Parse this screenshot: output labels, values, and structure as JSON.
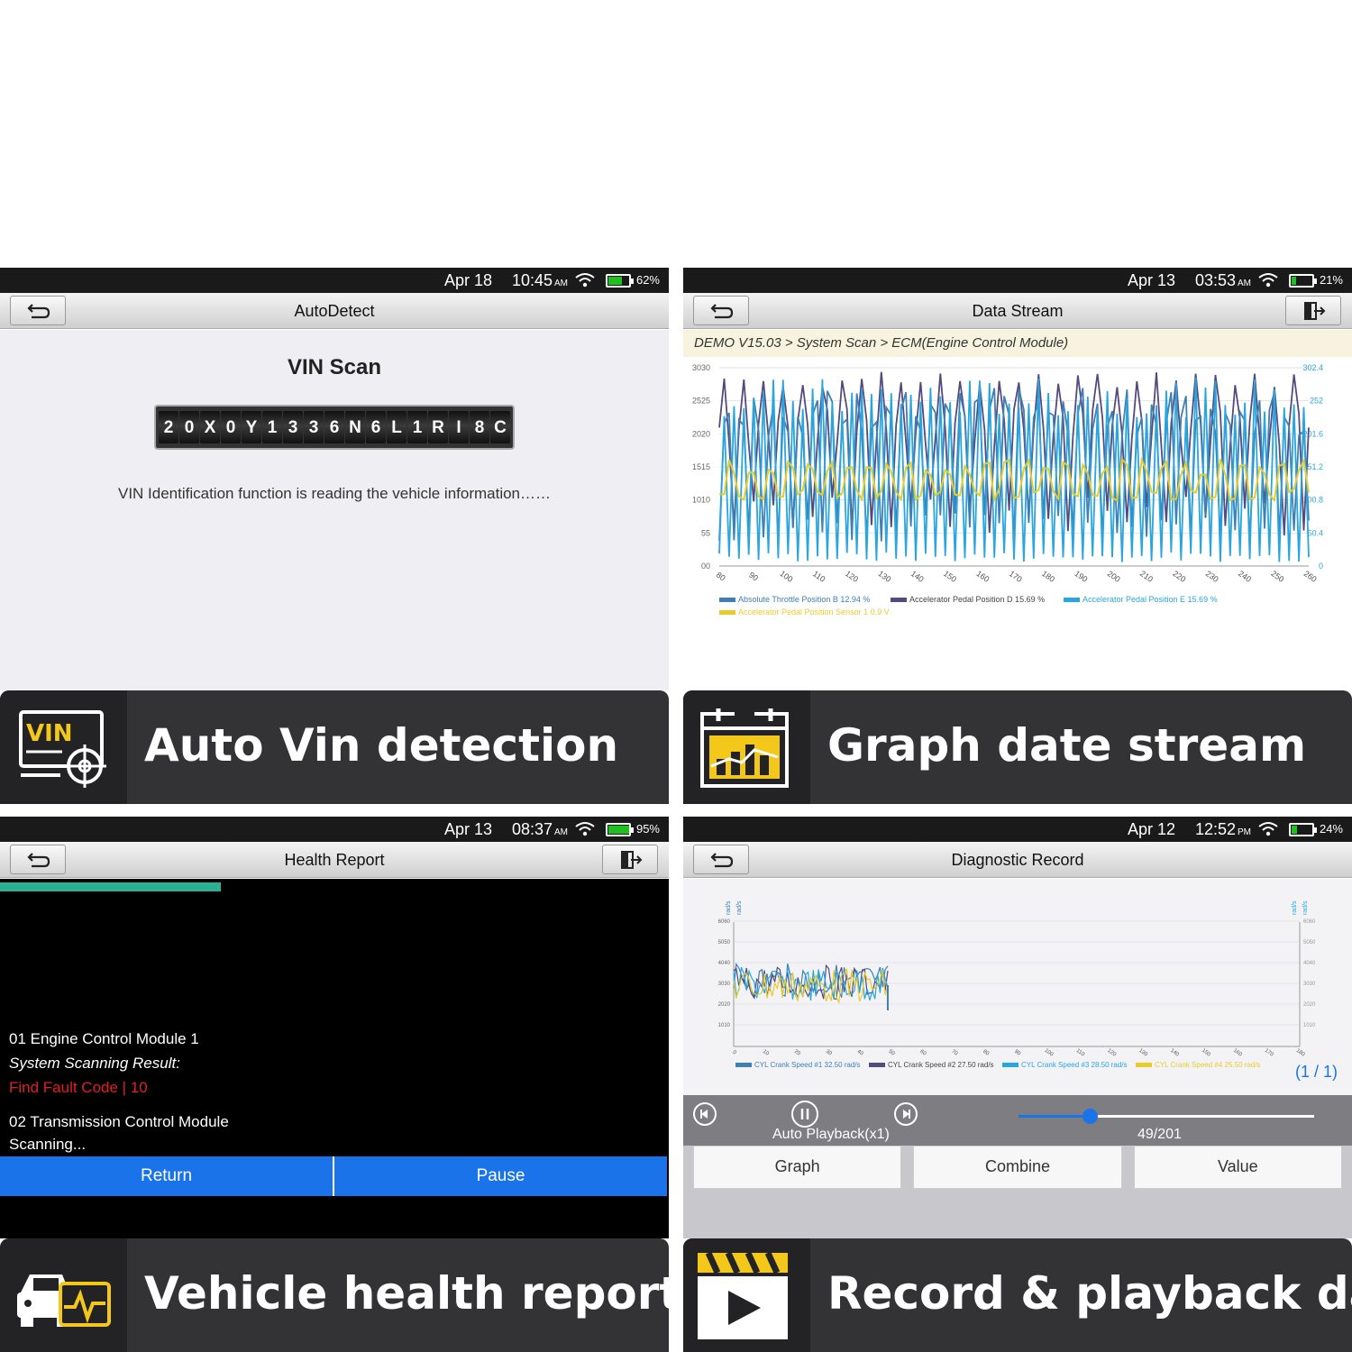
{
  "panels": [
    {
      "status": {
        "date": "Apr 18",
        "time": "10:45",
        "ampm": "AM",
        "battery": "62%",
        "battery_level": 0.62
      },
      "title": "AutoDetect",
      "vin_title": "VIN Scan",
      "vin_chars": [
        "2",
        "0",
        "X",
        "0",
        "Y",
        "1",
        "3",
        "3",
        "6",
        "N",
        "6",
        "L",
        "1",
        "R",
        "I",
        "8",
        "C"
      ],
      "message": "VIN Identification function is reading the vehicle information……",
      "caption": "Auto Vin detection",
      "icon": "vin-icon",
      "icon_text": "VIN"
    },
    {
      "status": {
        "date": "Apr 13",
        "time": "03:53",
        "ampm": "AM",
        "battery": "21%",
        "battery_level": 0.21
      },
      "title": "Data Stream",
      "breadcrumb": "DEMO V15.03 > System Scan > ECM(Engine Control Module)",
      "caption": "Graph date stream",
      "icon": "calendar-chart-icon"
    },
    {
      "status": {
        "date": "Apr 13",
        "time": "08:37",
        "ampm": "AM",
        "battery": "95%",
        "battery_level": 0.95
      },
      "title": "Health Report",
      "progress": 0.33,
      "lines": {
        "module1": "01 Engine Control Module 1",
        "result_label": "System Scanning Result:",
        "fault": "Find Fault Code | 10",
        "module2": "02 Transmission Control Module",
        "scanning": "Scanning..."
      },
      "buttons": {
        "return": "Return",
        "pause": "Pause"
      },
      "caption": "Vehicle health report",
      "icon": "car-health-icon"
    },
    {
      "status": {
        "date": "Apr 12",
        "time": "12:52",
        "ampm": "PM",
        "battery": "24%",
        "battery_level": 0.24
      },
      "title": "Diagnostic Record",
      "page": "(1 / 1)",
      "playback_label": "Auto Playback(x1)",
      "frame": "49/201",
      "frame_fraction": 0.24,
      "tabs": [
        "Graph",
        "Combine",
        "Value"
      ],
      "caption": "Record & playback date",
      "icon": "clapperboard-play-icon"
    }
  ],
  "colors": {
    "blue": "#29a6e0",
    "purple": "#554a7d",
    "yellow": "#e8cc2c",
    "steel": "#3f7fb3",
    "accent": "#1a73e8",
    "fault": "#e02020"
  },
  "chart_data": [
    {
      "type": "line",
      "xlim": [
        80,
        260
      ],
      "x_ticks": [
        80,
        90,
        100,
        110,
        120,
        130,
        140,
        150,
        160,
        170,
        180,
        190,
        200,
        210,
        220,
        230,
        240,
        250,
        260
      ],
      "y_ticks_left": [
        "00",
        "55",
        "1010",
        "1515",
        "2020",
        "2525",
        "3030"
      ],
      "y_ticks_right": [
        "0",
        "50.4",
        "100.8",
        "151.2",
        "201.6",
        "252",
        "302.4"
      ],
      "series": [
        {
          "name": "Absolute Throttle Position B 12.94 %",
          "color": "#3f7fb3"
        },
        {
          "name": "Accelerator Pedal Position D 15.69 %",
          "color": "#554a7d"
        },
        {
          "name": "Accelerator Pedal Position E 15.69 %",
          "color": "#29a6e0"
        },
        {
          "name": "Accelerator Pedal Position Sensor 1 0.9 V",
          "color": "#e8cc2c"
        }
      ]
    },
    {
      "type": "line",
      "xlim": [
        0,
        180
      ],
      "x_ticks": [
        0,
        10,
        20,
        30,
        40,
        50,
        60,
        70,
        80,
        90,
        100,
        110,
        120,
        130,
        140,
        150,
        160,
        170,
        180
      ],
      "y_ticks": [
        "1010",
        "2020",
        "3030",
        "4040",
        "5050",
        "6060"
      ],
      "y_units": "rad/s",
      "series": [
        {
          "name": "CYL Crank Speed #1 32.50 rad/s",
          "color": "#3f7fb3"
        },
        {
          "name": "CYL Crank Speed #2 27.50 rad/s",
          "color": "#554a7d"
        },
        {
          "name": "CYL Crank Speed #3 28.50 rad/s",
          "color": "#29a6e0"
        },
        {
          "name": "CYL Crank Speed #4 25.50 rad/s",
          "color": "#e8cc2c"
        }
      ]
    }
  ]
}
